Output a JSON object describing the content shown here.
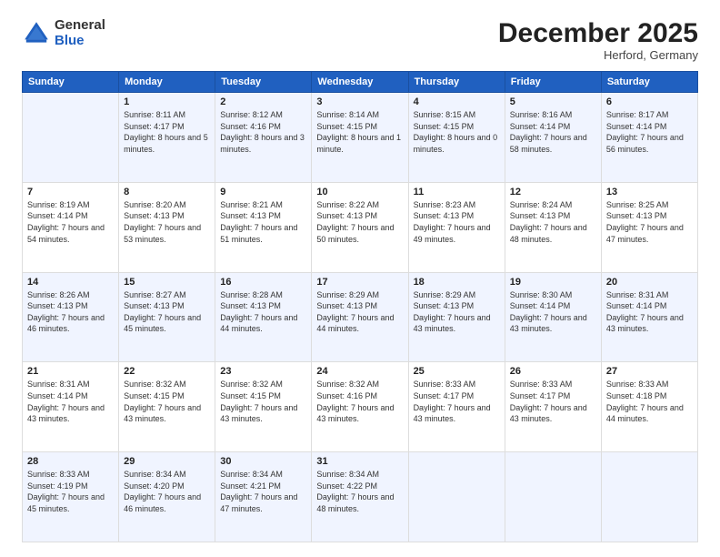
{
  "header": {
    "logo_general": "General",
    "logo_blue": "Blue",
    "title": "December 2025",
    "location": "Herford, Germany"
  },
  "days_of_week": [
    "Sunday",
    "Monday",
    "Tuesday",
    "Wednesday",
    "Thursday",
    "Friday",
    "Saturday"
  ],
  "weeks": [
    [
      {
        "day": "",
        "empty": true
      },
      {
        "day": "1",
        "sunrise": "Sunrise: 8:11 AM",
        "sunset": "Sunset: 4:17 PM",
        "daylight": "Daylight: 8 hours and 5 minutes."
      },
      {
        "day": "2",
        "sunrise": "Sunrise: 8:12 AM",
        "sunset": "Sunset: 4:16 PM",
        "daylight": "Daylight: 8 hours and 3 minutes."
      },
      {
        "day": "3",
        "sunrise": "Sunrise: 8:14 AM",
        "sunset": "Sunset: 4:15 PM",
        "daylight": "Daylight: 8 hours and 1 minute."
      },
      {
        "day": "4",
        "sunrise": "Sunrise: 8:15 AM",
        "sunset": "Sunset: 4:15 PM",
        "daylight": "Daylight: 8 hours and 0 minutes."
      },
      {
        "day": "5",
        "sunrise": "Sunrise: 8:16 AM",
        "sunset": "Sunset: 4:14 PM",
        "daylight": "Daylight: 7 hours and 58 minutes."
      },
      {
        "day": "6",
        "sunrise": "Sunrise: 8:17 AM",
        "sunset": "Sunset: 4:14 PM",
        "daylight": "Daylight: 7 hours and 56 minutes."
      }
    ],
    [
      {
        "day": "7",
        "sunrise": "Sunrise: 8:19 AM",
        "sunset": "Sunset: 4:14 PM",
        "daylight": "Daylight: 7 hours and 54 minutes."
      },
      {
        "day": "8",
        "sunrise": "Sunrise: 8:20 AM",
        "sunset": "Sunset: 4:13 PM",
        "daylight": "Daylight: 7 hours and 53 minutes."
      },
      {
        "day": "9",
        "sunrise": "Sunrise: 8:21 AM",
        "sunset": "Sunset: 4:13 PM",
        "daylight": "Daylight: 7 hours and 51 minutes."
      },
      {
        "day": "10",
        "sunrise": "Sunrise: 8:22 AM",
        "sunset": "Sunset: 4:13 PM",
        "daylight": "Daylight: 7 hours and 50 minutes."
      },
      {
        "day": "11",
        "sunrise": "Sunrise: 8:23 AM",
        "sunset": "Sunset: 4:13 PM",
        "daylight": "Daylight: 7 hours and 49 minutes."
      },
      {
        "day": "12",
        "sunrise": "Sunrise: 8:24 AM",
        "sunset": "Sunset: 4:13 PM",
        "daylight": "Daylight: 7 hours and 48 minutes."
      },
      {
        "day": "13",
        "sunrise": "Sunrise: 8:25 AM",
        "sunset": "Sunset: 4:13 PM",
        "daylight": "Daylight: 7 hours and 47 minutes."
      }
    ],
    [
      {
        "day": "14",
        "sunrise": "Sunrise: 8:26 AM",
        "sunset": "Sunset: 4:13 PM",
        "daylight": "Daylight: 7 hours and 46 minutes."
      },
      {
        "day": "15",
        "sunrise": "Sunrise: 8:27 AM",
        "sunset": "Sunset: 4:13 PM",
        "daylight": "Daylight: 7 hours and 45 minutes."
      },
      {
        "day": "16",
        "sunrise": "Sunrise: 8:28 AM",
        "sunset": "Sunset: 4:13 PM",
        "daylight": "Daylight: 7 hours and 44 minutes."
      },
      {
        "day": "17",
        "sunrise": "Sunrise: 8:29 AM",
        "sunset": "Sunset: 4:13 PM",
        "daylight": "Daylight: 7 hours and 44 minutes."
      },
      {
        "day": "18",
        "sunrise": "Sunrise: 8:29 AM",
        "sunset": "Sunset: 4:13 PM",
        "daylight": "Daylight: 7 hours and 43 minutes."
      },
      {
        "day": "19",
        "sunrise": "Sunrise: 8:30 AM",
        "sunset": "Sunset: 4:14 PM",
        "daylight": "Daylight: 7 hours and 43 minutes."
      },
      {
        "day": "20",
        "sunrise": "Sunrise: 8:31 AM",
        "sunset": "Sunset: 4:14 PM",
        "daylight": "Daylight: 7 hours and 43 minutes."
      }
    ],
    [
      {
        "day": "21",
        "sunrise": "Sunrise: 8:31 AM",
        "sunset": "Sunset: 4:14 PM",
        "daylight": "Daylight: 7 hours and 43 minutes."
      },
      {
        "day": "22",
        "sunrise": "Sunrise: 8:32 AM",
        "sunset": "Sunset: 4:15 PM",
        "daylight": "Daylight: 7 hours and 43 minutes."
      },
      {
        "day": "23",
        "sunrise": "Sunrise: 8:32 AM",
        "sunset": "Sunset: 4:15 PM",
        "daylight": "Daylight: 7 hours and 43 minutes."
      },
      {
        "day": "24",
        "sunrise": "Sunrise: 8:32 AM",
        "sunset": "Sunset: 4:16 PM",
        "daylight": "Daylight: 7 hours and 43 minutes."
      },
      {
        "day": "25",
        "sunrise": "Sunrise: 8:33 AM",
        "sunset": "Sunset: 4:17 PM",
        "daylight": "Daylight: 7 hours and 43 minutes."
      },
      {
        "day": "26",
        "sunrise": "Sunrise: 8:33 AM",
        "sunset": "Sunset: 4:17 PM",
        "daylight": "Daylight: 7 hours and 43 minutes."
      },
      {
        "day": "27",
        "sunrise": "Sunrise: 8:33 AM",
        "sunset": "Sunset: 4:18 PM",
        "daylight": "Daylight: 7 hours and 44 minutes."
      }
    ],
    [
      {
        "day": "28",
        "sunrise": "Sunrise: 8:33 AM",
        "sunset": "Sunset: 4:19 PM",
        "daylight": "Daylight: 7 hours and 45 minutes."
      },
      {
        "day": "29",
        "sunrise": "Sunrise: 8:34 AM",
        "sunset": "Sunset: 4:20 PM",
        "daylight": "Daylight: 7 hours and 46 minutes."
      },
      {
        "day": "30",
        "sunrise": "Sunrise: 8:34 AM",
        "sunset": "Sunset: 4:21 PM",
        "daylight": "Daylight: 7 hours and 47 minutes."
      },
      {
        "day": "31",
        "sunrise": "Sunrise: 8:34 AM",
        "sunset": "Sunset: 4:22 PM",
        "daylight": "Daylight: 7 hours and 48 minutes."
      },
      {
        "day": "",
        "empty": true
      },
      {
        "day": "",
        "empty": true
      },
      {
        "day": "",
        "empty": true
      }
    ]
  ]
}
